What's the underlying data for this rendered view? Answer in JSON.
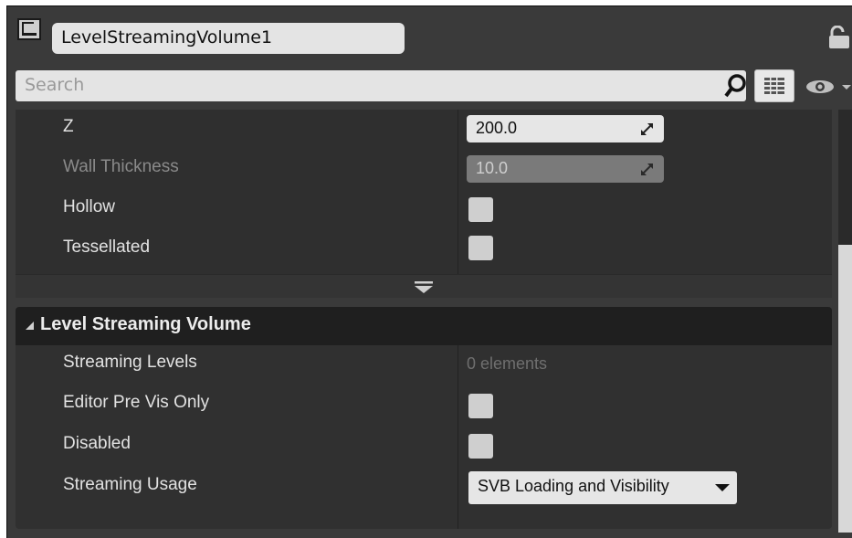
{
  "header": {
    "actor_name": "LevelStreamingVolume1"
  },
  "search": {
    "placeholder": "Search"
  },
  "brush_settings": {
    "rows": [
      {
        "label": "Z",
        "value": "200.0"
      },
      {
        "label": "Wall Thickness",
        "value": "10.0",
        "disabled": true
      },
      {
        "label": "Hollow",
        "checked": false
      },
      {
        "label": "Tessellated",
        "checked": false
      }
    ]
  },
  "level_streaming": {
    "title": "Level Streaming Volume",
    "streaming_levels_label": "Streaming Levels",
    "streaming_levels_value": "0 elements",
    "editor_pre_vis_only_label": "Editor Pre Vis Only",
    "disabled_label": "Disabled",
    "streaming_usage_label": "Streaming Usage",
    "streaming_usage_value": "SVB Loading and Visibility"
  },
  "icons": [
    "actor-icon",
    "lock-icon",
    "search-icon",
    "view-options-icon",
    "eye-icon",
    "expand-arrow-icon",
    "collapse-icon",
    "dropdown-arrow-icon"
  ]
}
